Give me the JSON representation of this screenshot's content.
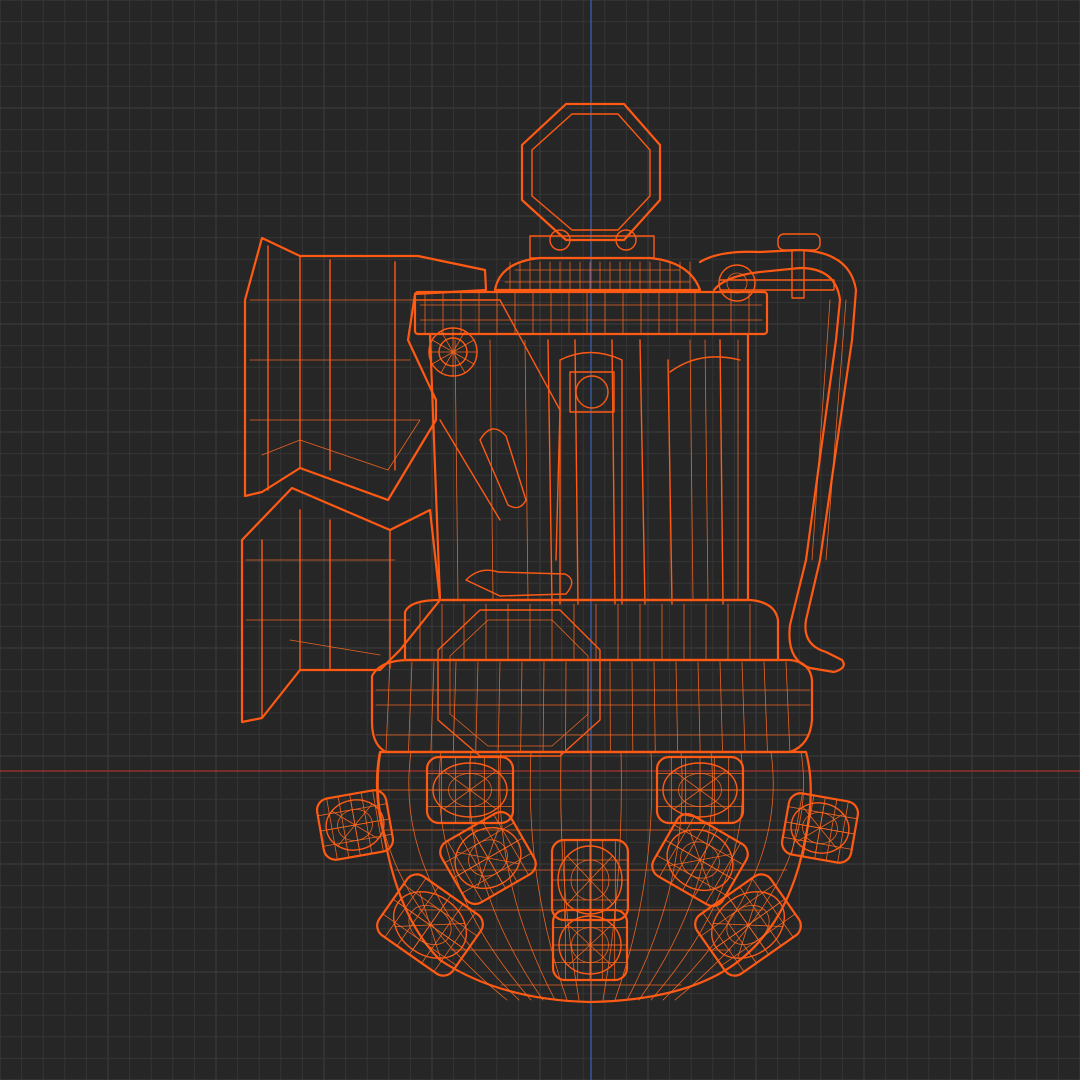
{
  "viewport": {
    "background": "#262626",
    "grid_minor_color": "#353535",
    "grid_major_color": "#3e3e3e",
    "x_axis_color": "#a8322d",
    "y_axis_color": "#3a62b8",
    "grid": true
  },
  "model": {
    "display_mode": "wireframe",
    "wire_color": "#ff5a14",
    "wire_dense_color": "#ff6a20",
    "subject": "grenade",
    "parts": [
      "pull-ring",
      "cap",
      "safety-lever",
      "body",
      "side-armor-plate",
      "lower-ring",
      "bottom-dome",
      "side-studs"
    ]
  }
}
